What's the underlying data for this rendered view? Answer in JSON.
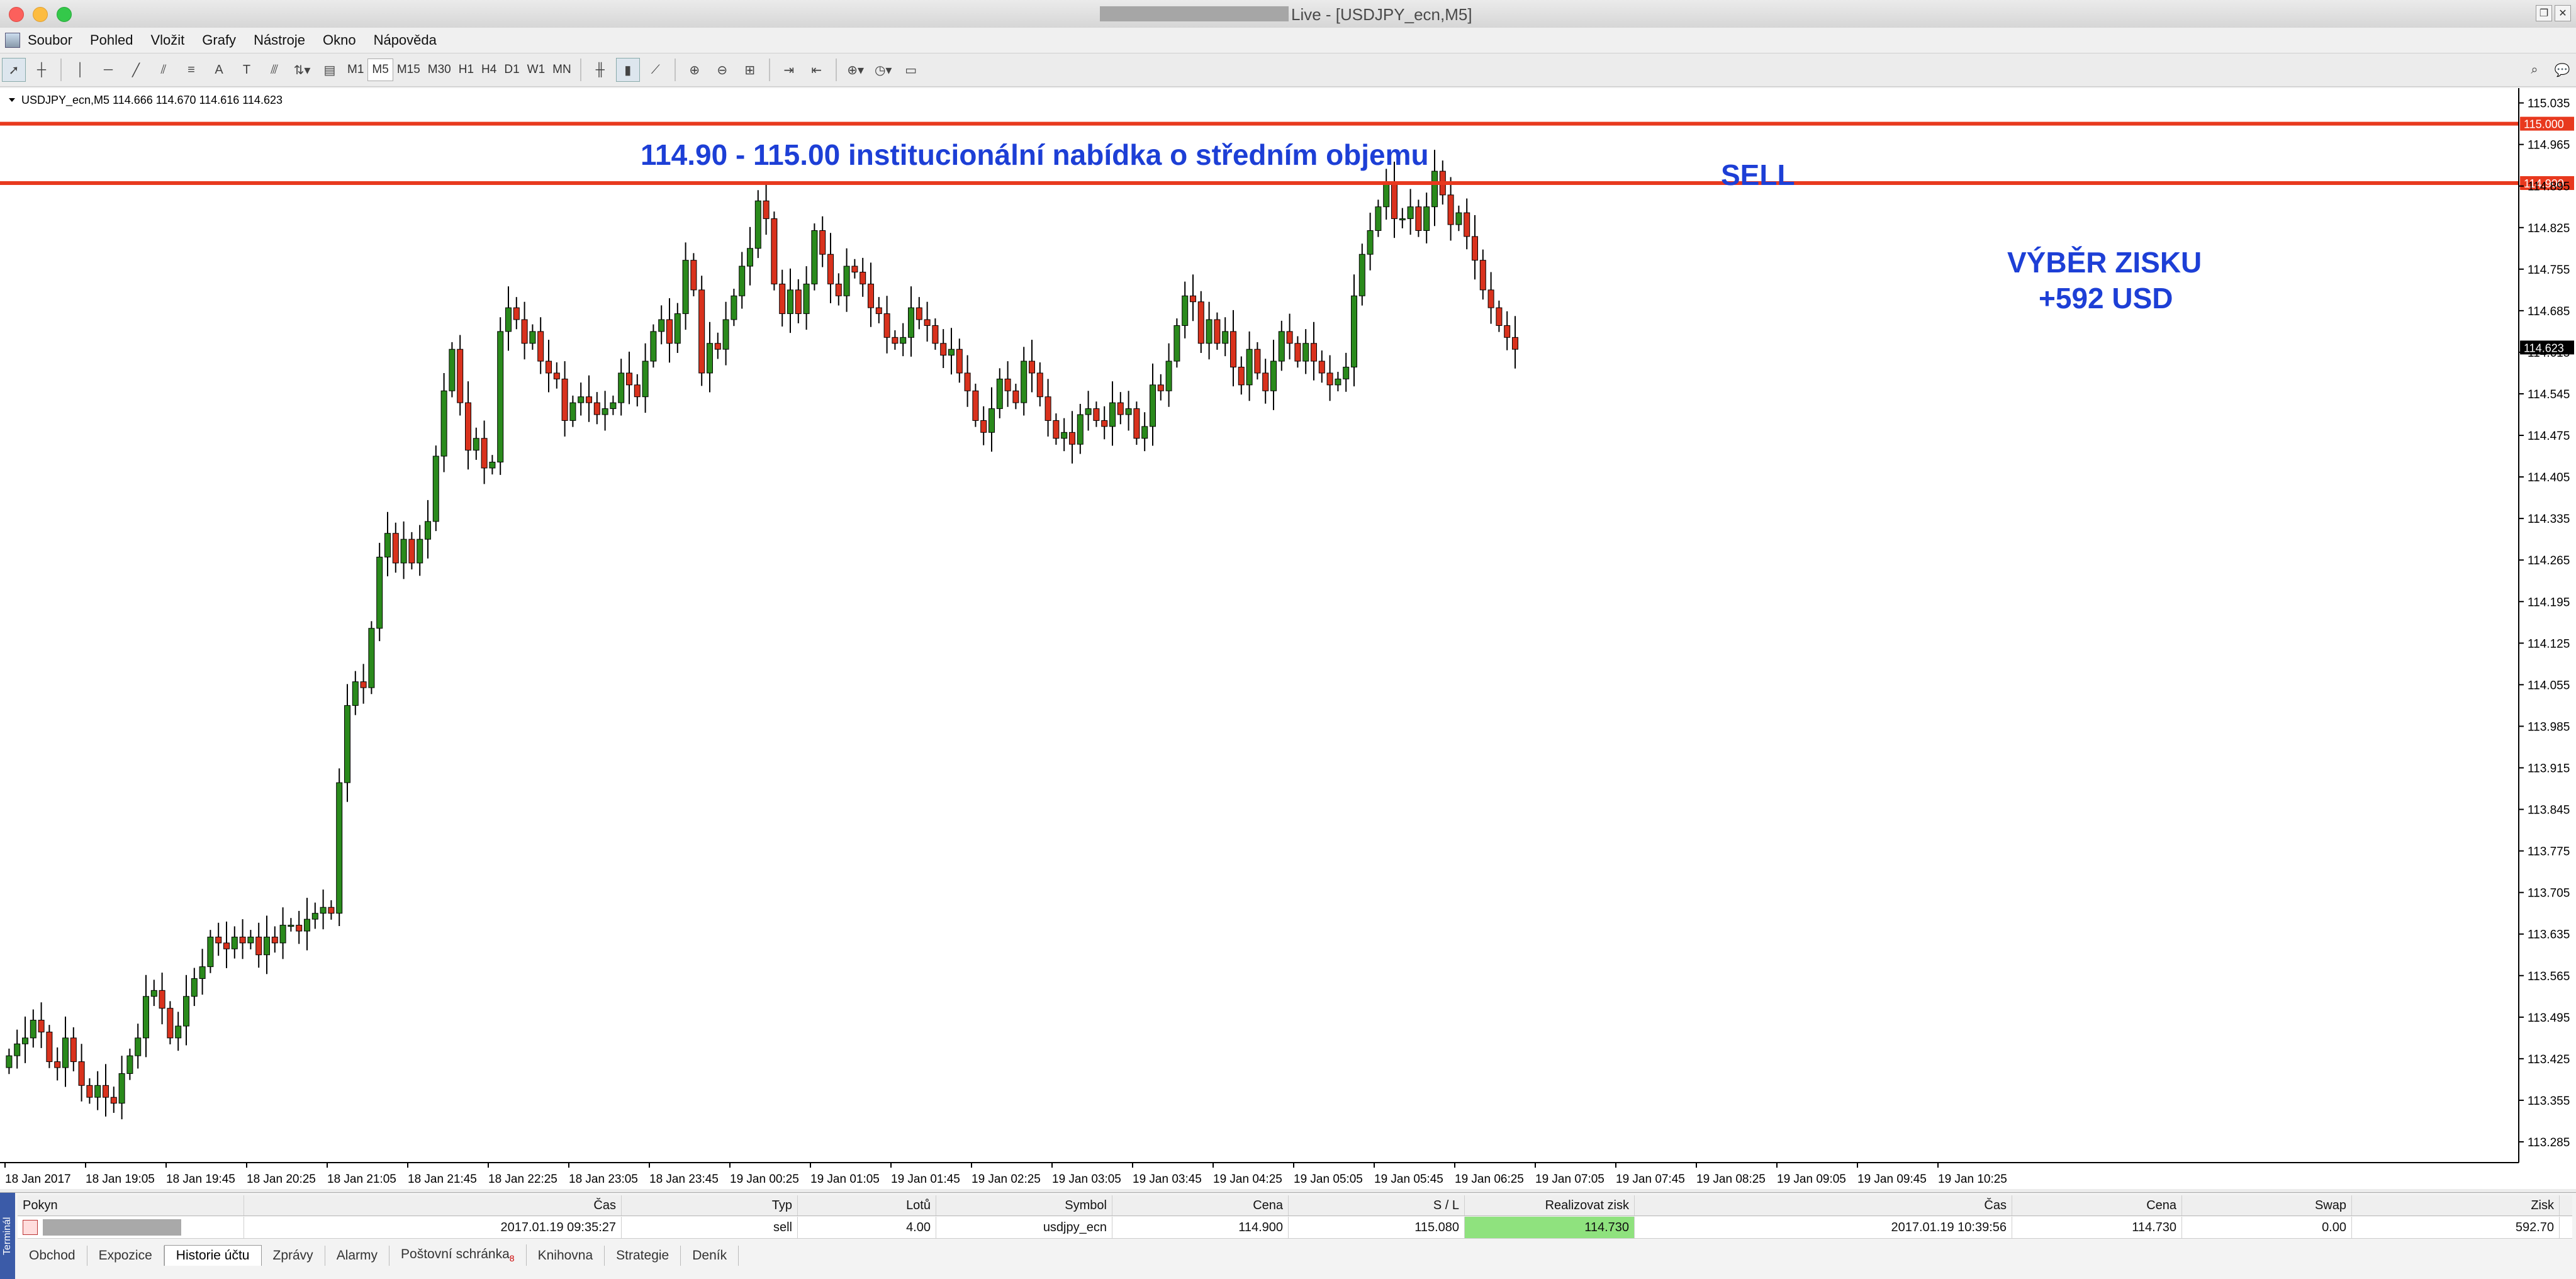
{
  "window": {
    "title": "Live - [USDJPY_ecn,M5]"
  },
  "menu": [
    "Soubor",
    "Pohled",
    "Vložit",
    "Grafy",
    "Nástroje",
    "Okno",
    "Nápověda"
  ],
  "toolbar": {
    "timeframes": [
      "M1",
      "M5",
      "M15",
      "M30",
      "H1",
      "H4",
      "D1",
      "W1",
      "MN"
    ],
    "active_timeframe": "M5"
  },
  "chart_data": {
    "type": "candlestick",
    "header": "USDJPY_ecn,M5  114.666 114.670 114.616 114.623",
    "current_price_label": "114.623",
    "ylim": [
      113.25,
      115.06
    ],
    "y_ticks": [
      "115.035",
      "114.965",
      "114.895",
      "114.825",
      "114.755",
      "114.685",
      "114.615",
      "114.545",
      "114.475",
      "114.405",
      "114.335",
      "114.265",
      "114.195",
      "114.125",
      "114.055",
      "113.985",
      "113.915",
      "113.845",
      "113.775",
      "113.705",
      "113.635",
      "113.565",
      "113.495",
      "113.425",
      "113.355",
      "113.285"
    ],
    "x_labels": [
      "18 Jan 2017",
      "18 Jan 19:05",
      "18 Jan 19:45",
      "18 Jan 20:25",
      "18 Jan 21:05",
      "18 Jan 21:45",
      "18 Jan 22:25",
      "18 Jan 23:05",
      "18 Jan 23:45",
      "19 Jan 00:25",
      "19 Jan 01:05",
      "19 Jan 01:45",
      "19 Jan 02:25",
      "19 Jan 03:05",
      "19 Jan 03:45",
      "19 Jan 04:25",
      "19 Jan 05:05",
      "19 Jan 05:45",
      "19 Jan 06:25",
      "19 Jan 07:05",
      "19 Jan 07:45",
      "19 Jan 08:25",
      "19 Jan 09:05",
      "19 Jan 09:45",
      "19 Jan 10:25"
    ],
    "levels": [
      {
        "price": 115.0,
        "label": "115.000",
        "color": "#e8391e"
      },
      {
        "price": 114.9,
        "label": "114.900",
        "color": "#e8391e"
      }
    ],
    "annotations": [
      {
        "text": "114.90 - 115.00 institucionální nabídka o středním objemu",
        "color": "#1d3fd6"
      },
      {
        "text": "SELL",
        "color": "#1d3fd6"
      },
      {
        "text": "VÝBĚR ZISKU",
        "color": "#1d3fd6"
      },
      {
        "text": "+592 USD",
        "color": "#1d3fd6"
      }
    ],
    "colors": {
      "bull": "#2a8a1c",
      "bear": "#d9321d",
      "wick": "#000000",
      "background": "#ffffff"
    },
    "close": [
      113.43,
      113.45,
      113.46,
      113.49,
      113.47,
      113.42,
      113.41,
      113.46,
      113.42,
      113.38,
      113.36,
      113.38,
      113.36,
      113.35,
      113.4,
      113.43,
      113.46,
      113.53,
      113.54,
      113.51,
      113.46,
      113.48,
      113.53,
      113.56,
      113.58,
      113.63,
      113.62,
      113.61,
      113.63,
      113.62,
      113.63,
      113.6,
      113.63,
      113.62,
      113.65,
      113.65,
      113.64,
      113.66,
      113.67,
      113.68,
      113.67,
      113.89,
      114.02,
      114.06,
      114.05,
      114.15,
      114.27,
      114.31,
      114.26,
      114.3,
      114.26,
      114.3,
      114.33,
      114.44,
      114.55,
      114.62,
      114.53,
      114.45,
      114.47,
      114.42,
      114.43,
      114.65,
      114.69,
      114.67,
      114.63,
      114.65,
      114.6,
      114.58,
      114.57,
      114.5,
      114.53,
      114.54,
      114.53,
      114.51,
      114.52,
      114.53,
      114.58,
      114.56,
      114.54,
      114.6,
      114.65,
      114.67,
      114.63,
      114.68,
      114.77,
      114.72,
      114.58,
      114.63,
      114.62,
      114.67,
      114.71,
      114.76,
      114.79,
      114.87,
      114.84,
      114.73,
      114.68,
      114.72,
      114.68,
      114.73,
      114.82,
      114.78,
      114.73,
      114.71,
      114.76,
      114.75,
      114.73,
      114.69,
      114.68,
      114.64,
      114.63,
      114.64,
      114.69,
      114.67,
      114.66,
      114.63,
      114.61,
      114.62,
      114.58,
      114.55,
      114.5,
      114.48,
      114.52,
      114.57,
      114.55,
      114.53,
      114.6,
      114.58,
      114.54,
      114.5,
      114.47,
      114.48,
      114.46,
      114.51,
      114.52,
      114.5,
      114.49,
      114.53,
      114.51,
      114.52,
      114.47,
      114.49,
      114.56,
      114.55,
      114.6,
      114.66,
      114.71,
      114.7,
      114.63,
      114.67,
      114.63,
      114.65,
      114.59,
      114.56,
      114.62,
      114.58,
      114.55,
      114.6,
      114.65,
      114.63,
      114.6,
      114.63,
      114.6,
      114.58,
      114.56,
      114.57,
      114.59,
      114.71,
      114.78,
      114.82,
      114.86,
      114.9,
      114.84,
      114.84,
      114.86,
      114.82,
      114.86,
      114.92,
      114.88,
      114.83,
      114.85,
      114.81,
      114.77,
      114.72,
      114.69,
      114.66,
      114.64,
      114.62
    ],
    "annotation_label_color": "#1d3fd6"
  },
  "terminal": {
    "side_label": "Terminál",
    "headers": [
      "Pokyn",
      "Čas",
      "Typ",
      "Lotů",
      "Symbol",
      "Cena",
      "S / L",
      "Realizovat zisk",
      "Čas",
      "Cena",
      "Swap",
      "Zisk"
    ],
    "row": {
      "open_time": "2017.01.19 09:35:27",
      "type": "sell",
      "lots": "4.00",
      "symbol": "usdjpy_ecn",
      "price": "114.900",
      "sl": "115.080",
      "tp": "114.730",
      "close_time": "2017.01.19 10:39:56",
      "close_price": "114.730",
      "swap": "0.00",
      "profit": "592.70"
    },
    "tabs": [
      "Obchod",
      "Expozice",
      "Historie účtu",
      "Zprávy",
      "Alarmy",
      "Poštovní schránka",
      "Knihovna",
      "Strategie",
      "Deník"
    ],
    "active_tab": "Historie účtu",
    "mailbox_badge": "8"
  }
}
